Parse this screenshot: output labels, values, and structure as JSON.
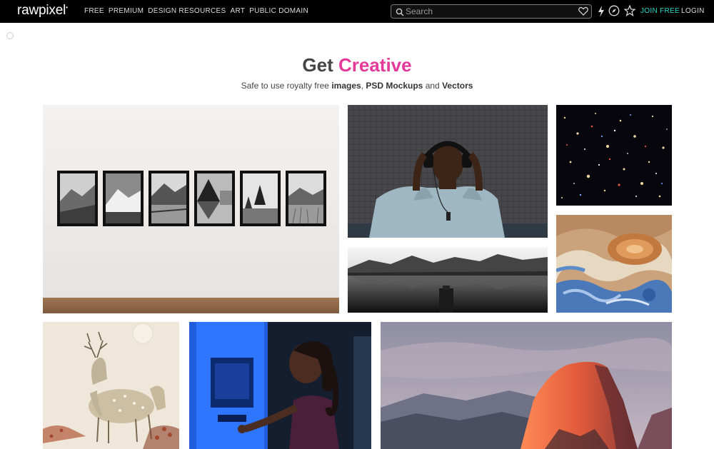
{
  "brand": {
    "logo": "rawpixel",
    "logo_mark": "•"
  },
  "nav": {
    "items": [
      {
        "label": "FREE"
      },
      {
        "label": "PREMIUM"
      },
      {
        "label": "DESIGN RESOURCES"
      },
      {
        "label": "ART"
      },
      {
        "label": "PUBLIC DOMAIN"
      }
    ]
  },
  "search": {
    "placeholder": "Search",
    "value": ""
  },
  "header_actions": {
    "icons": [
      "heart-icon",
      "lightning-icon",
      "compass-icon",
      "star-icon"
    ],
    "join_label": "JOIN FREE",
    "login_label": "LOGIN"
  },
  "hero": {
    "title_prefix": "Get ",
    "title_accent": "Creative",
    "subtitle_prefix": "Safe to use royalty free ",
    "subtitle_images": "images",
    "subtitle_sep": ", ",
    "subtitle_psd": "PSD Mockups",
    "subtitle_and": " and ",
    "subtitle_vectors": "Vectors"
  },
  "colors": {
    "accent": "#e5399a",
    "join": "#2bd9c7",
    "topbar": "#000000"
  },
  "gallery": {
    "tiles": [
      {
        "name": "framed-landscapes-gallery-wall"
      },
      {
        "name": "man-with-headphones"
      },
      {
        "name": "deep-space-galaxies"
      },
      {
        "name": "jupiter-clouds"
      },
      {
        "name": "lake-mountain-reflection"
      },
      {
        "name": "vintage-deer-illustration"
      },
      {
        "name": "woman-at-atm"
      },
      {
        "name": "half-dome-sunset"
      }
    ]
  }
}
